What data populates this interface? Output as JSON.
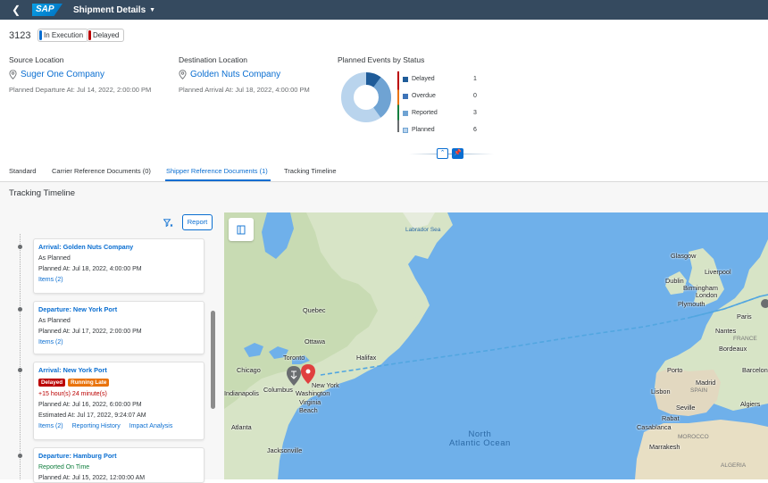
{
  "shell": {
    "back_icon": "chevron-left-icon",
    "logo": "SAP",
    "app_title": "Shipment Details"
  },
  "header": {
    "object_id": "3123",
    "status_execution": "In Execution",
    "status_delayed": "Delayed",
    "source": {
      "label": "Source Location",
      "name": "Suger One Company",
      "meta_label": "Planned Departure At:",
      "meta_value": "Jul 14, 2022, 2:00:00 PM"
    },
    "destination": {
      "label": "Destination Location",
      "name": "Golden Nuts Company",
      "meta_label": "Planned Arrival At:",
      "meta_value": "Jul 18, 2022, 4:00:00 PM"
    },
    "events": {
      "title": "Planned Events by Status",
      "items": [
        {
          "label": "Delayed",
          "value": "1",
          "color": "#1f5c99"
        },
        {
          "label": "Overdue",
          "value": "0",
          "color": "#3d74b8"
        },
        {
          "label": "Reported",
          "value": "3",
          "color": "#6fa3d3"
        },
        {
          "label": "Planned",
          "value": "6",
          "color": "#b9d4ed"
        }
      ]
    }
  },
  "tabs": [
    "Standard",
    "Carrier Reference Documents (0)",
    "Shipper Reference Documents (1)",
    "Tracking Timeline"
  ],
  "section_title": "Tracking Timeline",
  "report_button": "Report",
  "timeline": [
    {
      "title": "Arrival: Golden Nuts Company",
      "status": "As Planned",
      "planned": "Planned At: Jul 18, 2022, 4:00:00 PM",
      "items": "Items (2)"
    },
    {
      "title": "Departure: New York Port",
      "status": "As Planned",
      "planned": "Planned At: Jul 17, 2022, 2:00:00 PM",
      "items": "Items (2)"
    },
    {
      "title": "Arrival: New York Port",
      "badge_delayed": "Delayed",
      "badge_late": "Running Late",
      "delay": "+15 hour(s) 24 minute(s)",
      "planned": "Planned At: Jul 16, 2022, 6:00:00 PM",
      "estimated": "Estimated At: Jul 17, 2022, 9:24:07 AM",
      "items": "Items (2)",
      "reporting": "Reporting History",
      "impact": "Impact Analysis"
    },
    {
      "title": "Departure: Hamburg Port",
      "status": "Reported On Time",
      "planned": "Planned At: Jul 15, 2022, 12:00:00 AM"
    }
  ],
  "map": {
    "labels": {
      "labrador_sea": "Labrador Sea",
      "quebec": "Quebec",
      "ottawa": "Ottawa",
      "toronto": "Toronto",
      "chicago": "Chicago",
      "halifax": "Halifax",
      "new_york": "New York",
      "washington": "Washington",
      "virginia_beach": "Virginia\nBeach",
      "columbus": "Columbus",
      "indianapolis": "Indianapolis",
      "atlanta": "Atlanta",
      "jacksonville": "Jacksonville",
      "north_atlantic": "North\nAtlantic Ocean",
      "glasgow": "Glasgow",
      "dublin": "Dublin",
      "london": "London",
      "liverpool": "Liverpool",
      "birmingham": "Birmingham",
      "plymouth": "Plymouth",
      "paris": "Paris",
      "france": "FRANCE",
      "nantes": "Nantes",
      "bordeaux": "Bordeaux",
      "porto": "Porto",
      "spain": "SPAIN",
      "madrid": "Madrid",
      "lisbon": "Lisbon",
      "seville": "Seville",
      "casablanca": "Casablanca",
      "rabat": "Rabat",
      "morocco": "MOROCCO",
      "algiers": "Algiers",
      "algeria": "ALGERIA",
      "marrakesh": "Marrakesh",
      "barcelona": "Barcelona"
    }
  }
}
